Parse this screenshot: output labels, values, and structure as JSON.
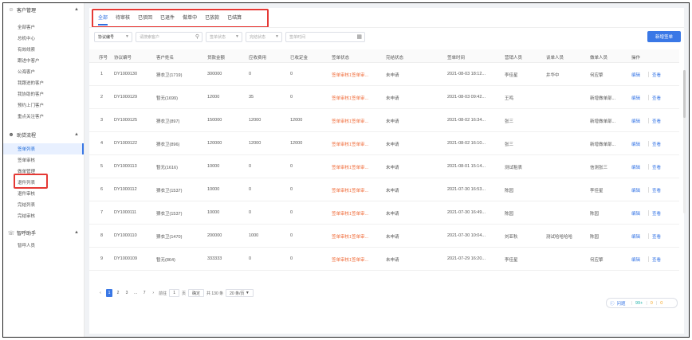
{
  "sidebar": {
    "groups": [
      {
        "label": "客户管理",
        "icon": "users-icon",
        "items": [
          "全部客户",
          "总机中心",
          "有效线索",
          "跟进中客户",
          "公海客户",
          "我跟进的客户",
          "我协助的客户",
          "预约上门客户",
          "重点关注客户"
        ]
      },
      {
        "label": "助贷流程",
        "icon": "person-icon",
        "items": [
          "签单列表",
          "签单审核",
          "做单管理",
          "退件列表",
          "退件审核",
          "完结列表",
          "完结审核"
        ],
        "active": "签单列表"
      },
      {
        "label": "智呼助手",
        "icon": "headset-icon",
        "items": [
          "智呼人员"
        ]
      }
    ]
  },
  "tabs": [
    "全部",
    "待审核",
    "已驳回",
    "已退件",
    "做单中",
    "已放款",
    "已结算"
  ],
  "filters": {
    "type_select": "协议编号",
    "customer_placeholder": "请搜索客户",
    "status_placeholder": "签单状态",
    "done_placeholder": "完结状态",
    "time_placeholder": "签单时间",
    "new_button": "新增签单"
  },
  "table": {
    "columns": [
      "序号",
      "协议编号",
      "客户姓名",
      "贷款金额",
      "应收费用",
      "已收定金",
      "签单状态",
      "完结状态",
      "签单时间",
      "营销人员",
      "谈单人员",
      "做单人员",
      "操作"
    ],
    "rows": [
      [
        "1",
        "DY1000130",
        "猜衣卫(1719)",
        "300000",
        "0",
        "0",
        "签单审核1签单审...",
        "未申请",
        "2021-08-03 18:12...",
        "李佳星",
        "井华中",
        "何应擎",
        "编辑",
        "查看"
      ],
      [
        "2",
        "DY1000129",
        "暂无(1699)",
        "12000",
        "35",
        "0",
        "签单审核1签单审...",
        "未申请",
        "2021-08-03 09:42...",
        "王鸣",
        "",
        "新增做单部...",
        "编辑",
        "查看"
      ],
      [
        "3",
        "DY1000125",
        "猜衣卫(897)",
        "150000",
        "12000",
        "12000",
        "签单审核1签单审...",
        "未申请",
        "2021-08-02 16:34...",
        "张三",
        "",
        "新增做单部...",
        "编辑",
        "查看"
      ],
      [
        "4",
        "DY1000122",
        "猜衣卫(896)",
        "120000",
        "12000",
        "12000",
        "签单审核1签单审...",
        "未申请",
        "2021-08-02 16:10...",
        "张三",
        "",
        "新增做单部...",
        "编辑",
        "查看"
      ],
      [
        "5",
        "DY1000113",
        "暂无(1616)",
        "10000",
        "0",
        "0",
        "签单审核1签单审...",
        "未申请",
        "2021-08-01 15:14...",
        "测试租表",
        "",
        "信测张三",
        "编辑",
        "查看"
      ],
      [
        "6",
        "DY1000112",
        "猜衣卫(1537)",
        "10000",
        "0",
        "0",
        "签单审核1签单审...",
        "未申请",
        "2021-07-30 16:53...",
        "陈园",
        "",
        "李佳星",
        "编辑",
        "查看"
      ],
      [
        "7",
        "DY1000111",
        "猜衣卫(1537)",
        "10000",
        "0",
        "0",
        "签单审核1签单审...",
        "未申请",
        "2021-07-30 16:49...",
        "陈园",
        "",
        "陈园",
        "编辑",
        "查看"
      ],
      [
        "8",
        "DY1000110",
        "猜衣卫(1470)",
        "200000",
        "1000",
        "0",
        "签单审核1签单审...",
        "未申请",
        "2021-07-30 10:04...",
        "刘亚秋",
        "测试哈哈哈哈",
        "陈园",
        "编辑",
        "查看"
      ],
      [
        "9",
        "DY1000109",
        "暂无(864)",
        "333333",
        "0",
        "0",
        "签单审核1签单审...",
        "未申请",
        "2021-07-29 16:20...",
        "李佳星",
        "",
        "何应擎",
        "编辑",
        "查看"
      ],
      [
        "10",
        "DY1000108",
        "暂无(864)",
        "1000",
        "0",
        "0",
        "签单审核1签单审...",
        "未申请",
        "2021-07-29 16:18...",
        "胡江三",
        "",
        "",
        "编辑",
        "查看"
      ]
    ]
  },
  "pager": {
    "pages": [
      "1",
      "2",
      "3",
      "...",
      "7"
    ],
    "goto_label": "前往",
    "goto_value": "1",
    "page_unit": "页",
    "confirm": "确定",
    "total": "共 130 条",
    "page_size": "20 条/页"
  },
  "stats": {
    "label": "问题",
    "v1": "99+",
    "v2": "0",
    "v3": "0"
  },
  "colors": {
    "accent": "#3a78e6",
    "status_red": "#f06c3a",
    "highlight_box": "#e53935"
  }
}
